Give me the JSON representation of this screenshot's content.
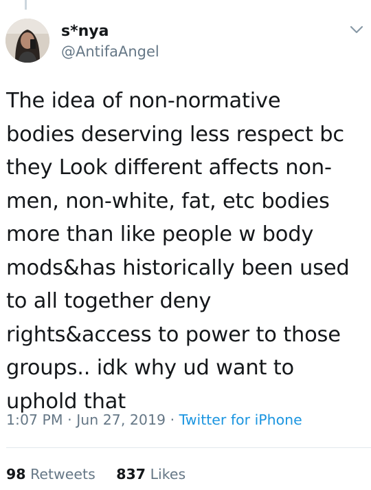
{
  "tweet": {
    "author": {
      "display_name": "s*nya",
      "handle": "@AntifaAngel",
      "avatar_icon": "avatar-photo"
    },
    "menu_icon": "chevron-down-icon",
    "text": "The idea of non-normative\nbodies deserving less respect bc\nthey Look different affects non-\nmen, non-white, fat, etc bodies\nmore than like people w body\nmods&has historically been used\nto all together deny\nrights&access to power to those\ngroups.. idk why ud want to\nuphold that",
    "time": "1:07 PM",
    "separator": "·",
    "date": "Jun 27, 2019",
    "source": "Twitter for iPhone",
    "stats": {
      "retweets_count": "98",
      "retweets_label": "Retweets",
      "likes_count": "837",
      "likes_label": "Likes"
    }
  },
  "colors": {
    "text": "#14171a",
    "secondary": "#657786",
    "link": "#1b95e0",
    "divider": "#e1e8ed"
  }
}
